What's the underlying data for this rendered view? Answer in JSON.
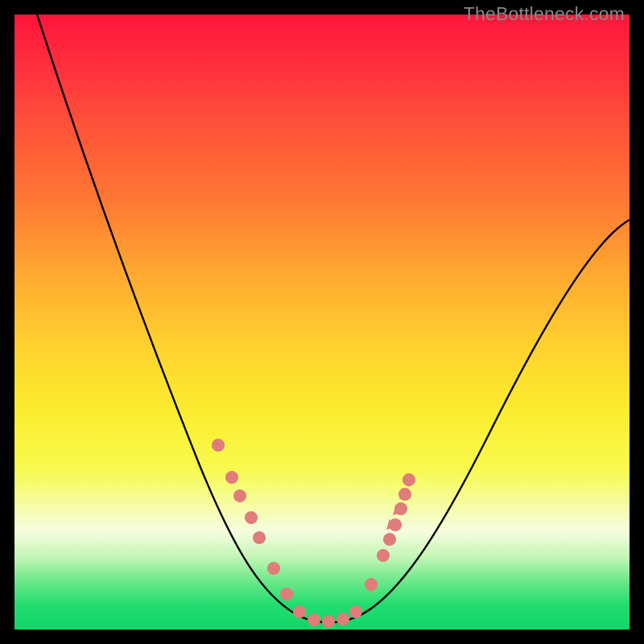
{
  "watermark": "TheBottleneck.com",
  "chart_data": {
    "type": "line",
    "title": "",
    "xlabel": "",
    "ylabel": "",
    "xlim": [
      0,
      100
    ],
    "ylim": [
      0,
      100
    ],
    "series": [
      {
        "name": "bottleneck-curve",
        "x": [
          3,
          10,
          18,
          25,
          32,
          38,
          42,
          45,
          48,
          50,
          52,
          55,
          58,
          62,
          70,
          80,
          90,
          100
        ],
        "y": [
          100,
          84,
          68,
          52,
          38,
          26,
          17,
          9,
          3,
          1,
          3,
          9,
          17,
          26,
          42,
          58,
          72,
          64
        ]
      }
    ],
    "markers": {
      "name": "data-points",
      "points": [
        {
          "x": 33,
          "y": 30
        },
        {
          "x": 35.5,
          "y": 24
        },
        {
          "x": 37,
          "y": 21
        },
        {
          "x": 39,
          "y": 17
        },
        {
          "x": 40.5,
          "y": 14
        },
        {
          "x": 43,
          "y": 9
        },
        {
          "x": 45,
          "y": 4
        },
        {
          "x": 47,
          "y": 2
        },
        {
          "x": 49,
          "y": 1
        },
        {
          "x": 51,
          "y": 1
        },
        {
          "x": 53,
          "y": 2
        },
        {
          "x": 55,
          "y": 5
        },
        {
          "x": 58,
          "y": 12
        },
        {
          "x": 60,
          "y": 17
        },
        {
          "x": 61,
          "y": 19
        },
        {
          "x": 62,
          "y": 22
        },
        {
          "x": 63,
          "y": 25
        },
        {
          "x": 63.5,
          "y": 27.5
        },
        {
          "x": 64,
          "y": 30
        }
      ],
      "color": "#e07c7a"
    },
    "gradient_stops": [
      {
        "pos": 0,
        "color": "#ff153a"
      },
      {
        "pos": 50,
        "color": "#ffd22e"
      },
      {
        "pos": 100,
        "color": "#0fd767"
      }
    ]
  }
}
